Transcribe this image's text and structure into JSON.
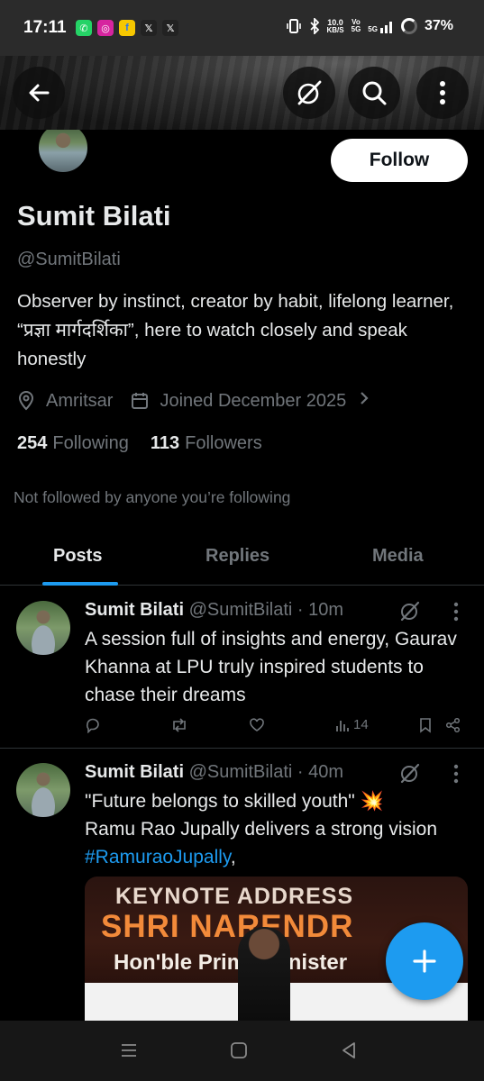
{
  "status_bar": {
    "time": "17:11",
    "apps": [
      {
        "icon": "whatsapp-icon",
        "glyph": "✆",
        "color": "#25d366"
      },
      {
        "icon": "instagram-icon",
        "glyph": "◎",
        "color": "#d6249f"
      },
      {
        "icon": "flipkart-icon",
        "glyph": "f",
        "color": "#2874f0"
      },
      {
        "icon": "x-icon",
        "glyph": "𝕏",
        "color": "#000000"
      },
      {
        "icon": "x-icon",
        "glyph": "𝕏",
        "color": "#000000"
      }
    ],
    "net_speed": "10.0",
    "net_unit": "KB/S",
    "volte": "Vo",
    "volte2": "5G",
    "network": "5G",
    "battery": "37%"
  },
  "profile": {
    "name": "Sumit Bilati",
    "handle": "@SumitBilati",
    "bio": "Observer by instinct, creator by habit, lifelong learner, “प्रज्ञा मार्गदर्शिका”, here to watch closely and speak honestly",
    "location": "Amritsar",
    "joined": "Joined December 2025",
    "following_count": "254",
    "following_label": "Following",
    "followers_count": "113",
    "followers_label": "Followers",
    "not_followed": "Not followed by anyone you’re following",
    "follow_label": "Follow"
  },
  "tabs": [
    {
      "label": "Posts",
      "active": true
    },
    {
      "label": "Replies",
      "active": false
    },
    {
      "label": "Media",
      "active": false
    }
  ],
  "posts": [
    {
      "author": "Sumit Bilati",
      "handle": "@SumitBilati",
      "time": "· 10m",
      "text": "A session full of insights and energy, Gaurav Khanna at LPU truly inspired students to chase their dreams",
      "views": "14"
    },
    {
      "author": "Sumit Bilati",
      "handle": "@SumitBilati",
      "time": "· 40m",
      "text_line1": "\"Future belongs to skilled youth\" 💥",
      "text_line2": "Ramu Rao Jupally delivers a strong vision",
      "hashtag": "#RamuraoJupally",
      "after_hashtag": ",",
      "image": {
        "line1": "KEYNOTE ADDRESS",
        "line2": "SHRI NARENDR",
        "line3": "Hon'ble Prime Minister"
      }
    }
  ],
  "colors": {
    "accent": "#1d9bf0",
    "muted": "#71767b",
    "text": "#e7e9ea",
    "background": "#000000"
  }
}
